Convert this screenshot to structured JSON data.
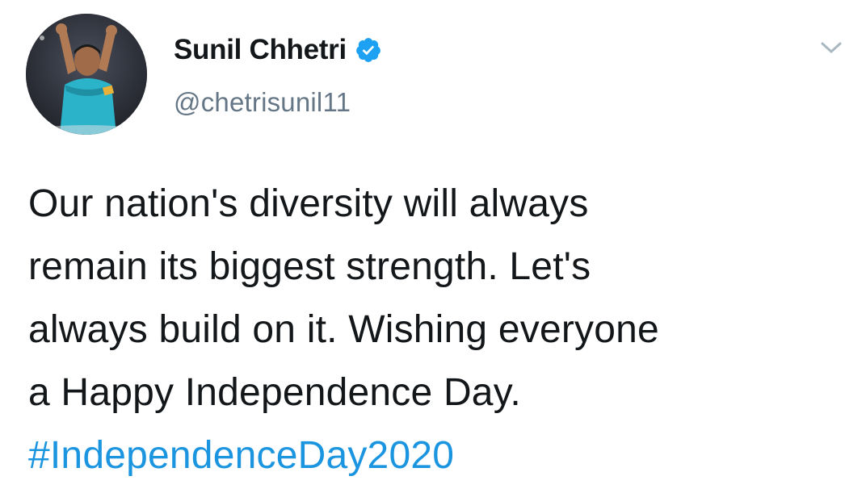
{
  "author": {
    "display_name": "Sunil Chhetri",
    "handle": "@chetrisunil11",
    "verified": true,
    "avatar_icon": "profile-photo"
  },
  "tweet": {
    "lines": [
      "Our nation's diversity will always",
      "remain its biggest strength. Let's",
      "always build on it. Wishing everyone",
      "a Happy Independence Day."
    ],
    "hashtag": "#IndependenceDay2020"
  },
  "colors": {
    "text": "#14171a",
    "secondary": "#657786",
    "link": "#1b95e0",
    "verified_badge": "#1da1f2"
  },
  "icons": {
    "verified": "verified-badge-icon",
    "menu": "chevron-down-icon"
  }
}
